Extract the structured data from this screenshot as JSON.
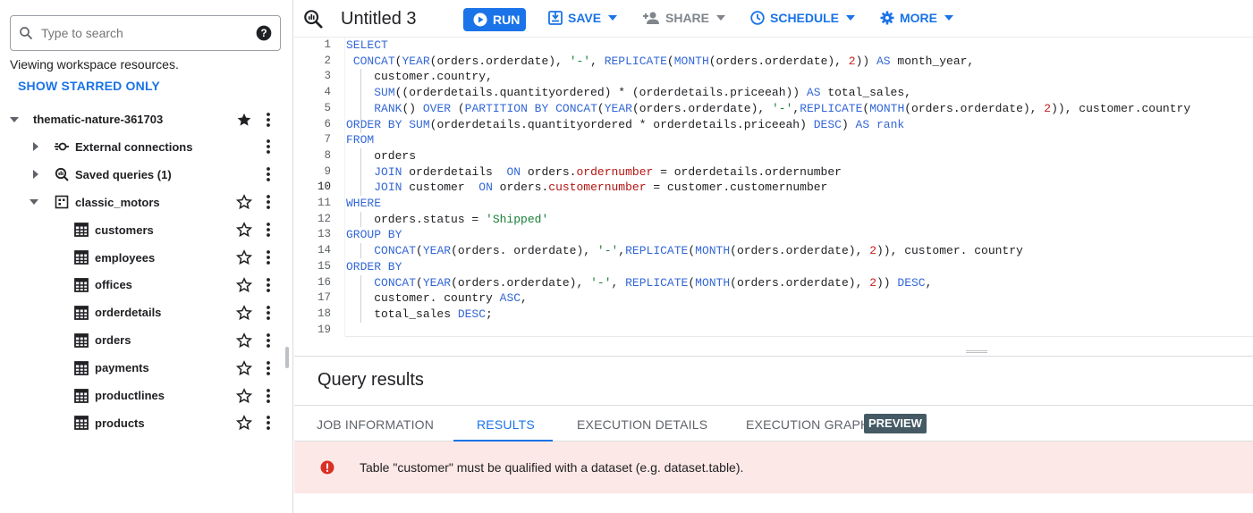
{
  "sidebar": {
    "search_placeholder": "Type to search",
    "viewing_text": "Viewing workspace resources.",
    "show_starred_label": "SHOW STARRED ONLY",
    "project": {
      "name": "thematic-nature-361703",
      "starred": true
    },
    "items": [
      {
        "label": "External connections",
        "icon": "connection-icon"
      },
      {
        "label": "Saved queries (1)",
        "icon": "saved-query-icon"
      },
      {
        "label": "classic_motors",
        "icon": "dataset-icon"
      }
    ],
    "tables": [
      "customers",
      "employees",
      "offices",
      "orderdetails",
      "orders",
      "payments",
      "productlines",
      "products"
    ]
  },
  "toolbar": {
    "title": "Untitled 3",
    "run_label": "RUN",
    "save_label": "SAVE",
    "share_label": "SHARE",
    "schedule_label": "SCHEDULE",
    "more_label": "MORE"
  },
  "editor": {
    "active_line": 10,
    "line_numbers": [
      "1",
      "2",
      "3",
      "4",
      "5",
      "6",
      "7",
      "8",
      "9",
      "10",
      "11",
      "12",
      "13",
      "14",
      "15",
      "16",
      "17",
      "18",
      "19"
    ]
  },
  "results": {
    "title": "Query results",
    "tabs": [
      "JOB INFORMATION",
      "RESULTS",
      "EXECUTION DETAILS",
      "EXECUTION GRAPH"
    ],
    "active_tab": "RESULTS",
    "preview_badge": "PREVIEW",
    "error_message": "Table \"customer\" must be qualified with a dataset (e.g. dataset.table)."
  },
  "colors": {
    "accent": "#1a73e8",
    "error_bg": "#fce8e6",
    "error_icon": "#d93025"
  }
}
